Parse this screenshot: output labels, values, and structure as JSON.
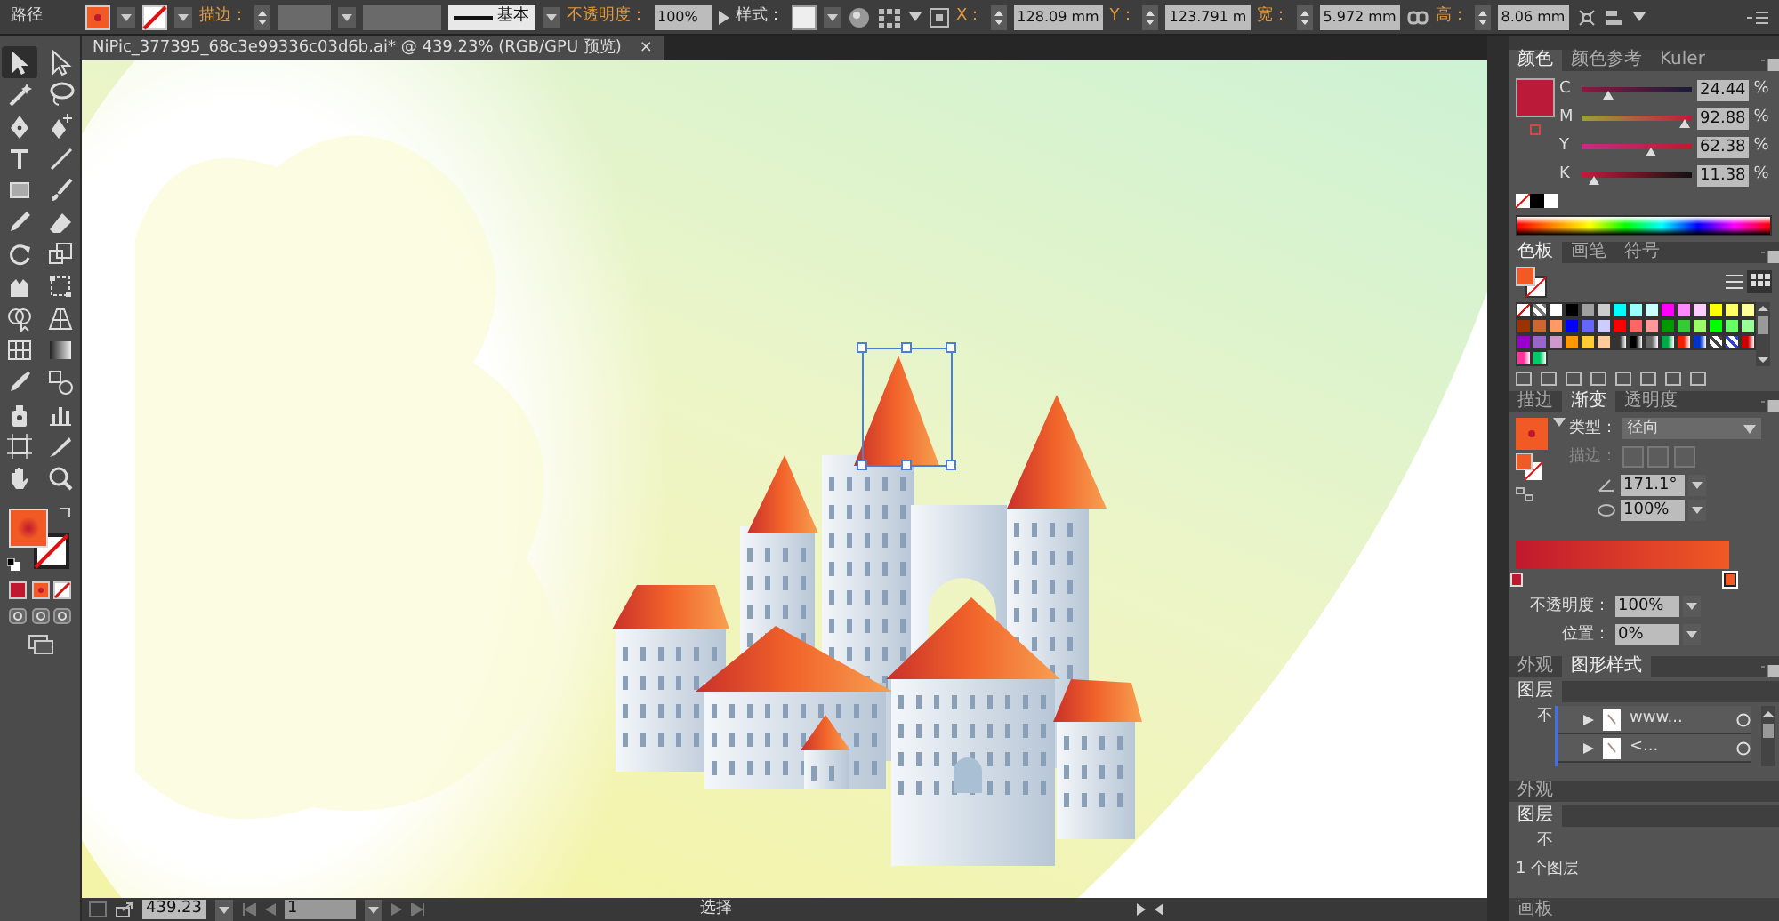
{
  "control_bar": {
    "object_type": "路径",
    "stroke_label": "描边：",
    "stroke_profile": "基本",
    "opacity_label": "不透明度：",
    "opacity": "100%",
    "style_label": "样式：",
    "x_label": "X：",
    "x": "128.09 mm",
    "y_label": "Y：",
    "y": "123.791 m",
    "w_label": "宽：",
    "w": "5.972 mm",
    "h_label": "高：",
    "h": "8.06 mm"
  },
  "document_tab": {
    "title": "NiPic_377395_68c3e99336c03d6b.ai* @ 439.23% (RGB/GPU 预览)",
    "close": "×"
  },
  "tools": [
    {
      "kind": "selection",
      "selected": true
    },
    {
      "kind": "direct-selection",
      "selected": false
    },
    {
      "kind": "magic-wand",
      "selected": false
    },
    {
      "kind": "lasso",
      "selected": false
    },
    {
      "kind": "pen",
      "selected": false
    },
    {
      "kind": "pen-add",
      "selected": false
    },
    {
      "kind": "type",
      "selected": false
    },
    {
      "kind": "line",
      "selected": false
    },
    {
      "kind": "rectangle",
      "selected": false
    },
    {
      "kind": "brush",
      "selected": false
    },
    {
      "kind": "pencil",
      "selected": false
    },
    {
      "kind": "eraser",
      "selected": false
    },
    {
      "kind": "rotate",
      "selected": false
    },
    {
      "kind": "scale",
      "selected": false
    },
    {
      "kind": "warp",
      "selected": false
    },
    {
      "kind": "free-transform",
      "selected": false
    },
    {
      "kind": "shape-builder",
      "selected": false
    },
    {
      "kind": "perspective",
      "selected": false
    },
    {
      "kind": "mesh",
      "selected": false
    },
    {
      "kind": "gradient",
      "selected": false
    },
    {
      "kind": "eyedropper",
      "selected": false
    },
    {
      "kind": "blend",
      "selected": false
    },
    {
      "kind": "sprayer",
      "selected": false
    },
    {
      "kind": "graph",
      "selected": false
    },
    {
      "kind": "artboard",
      "selected": false
    },
    {
      "kind": "slice",
      "selected": false
    },
    {
      "kind": "hand",
      "selected": false
    },
    {
      "kind": "zoom",
      "selected": false
    }
  ],
  "color_panel": {
    "tabs": [
      {
        "label": "颜色",
        "selected": true
      },
      {
        "label": "颜色参考",
        "selected": false
      },
      {
        "label": "Kuler",
        "selected": false
      }
    ],
    "channels": [
      {
        "label": "C",
        "value": "24.44",
        "unit": "%",
        "level": 0.2444
      },
      {
        "label": "M",
        "value": "92.88",
        "unit": "%",
        "level": 0.9288
      },
      {
        "label": "Y",
        "value": "62.38",
        "unit": "%",
        "level": 0.6238
      },
      {
        "label": "K",
        "value": "11.38",
        "unit": "%",
        "level": 0.1138
      }
    ]
  },
  "swatches_panel": {
    "tabs": [
      {
        "label": "色板",
        "selected": true
      },
      {
        "label": "画笔",
        "selected": false
      },
      {
        "label": "符号",
        "selected": false
      }
    ],
    "swatches": [
      {
        "kind": "none"
      },
      {
        "kind": "pattern",
        "color": "#777777"
      },
      {
        "kind": "color",
        "color": "#ffffff"
      },
      {
        "kind": "color",
        "color": "#000000"
      },
      {
        "kind": "color",
        "color": "#a0a0a0"
      },
      {
        "kind": "color",
        "color": "#cccccc"
      },
      {
        "kind": "color",
        "color": "#00ffff"
      },
      {
        "kind": "color",
        "color": "#99ffff"
      },
      {
        "kind": "color",
        "color": "#ccffff"
      },
      {
        "kind": "color",
        "color": "#ff00ff"
      },
      {
        "kind": "color",
        "color": "#ff88ff"
      },
      {
        "kind": "color",
        "color": "#ffccff"
      },
      {
        "kind": "color",
        "color": "#ffff00"
      },
      {
        "kind": "color",
        "color": "#ffff66"
      },
      {
        "kind": "color",
        "color": "#ffff99"
      },
      {
        "kind": "color",
        "color": "#993300"
      },
      {
        "kind": "color",
        "color": "#cc6633"
      },
      {
        "kind": "color",
        "color": "#ff9966"
      },
      {
        "kind": "color",
        "color": "#0000ff"
      },
      {
        "kind": "color",
        "color": "#6666ff"
      },
      {
        "kind": "color",
        "color": "#ccccff"
      },
      {
        "kind": "color",
        "color": "#ff0000"
      },
      {
        "kind": "color",
        "color": "#ff6666"
      },
      {
        "kind": "color",
        "color": "#ff9999"
      },
      {
        "kind": "color",
        "color": "#009900"
      },
      {
        "kind": "color",
        "color": "#33cc33"
      },
      {
        "kind": "color",
        "color": "#99ff66"
      },
      {
        "kind": "color",
        "color": "#00ff00"
      },
      {
        "kind": "color",
        "color": "#66ff66"
      },
      {
        "kind": "color",
        "color": "#99ff99"
      },
      {
        "kind": "color",
        "color": "#9900cc"
      },
      {
        "kind": "color",
        "color": "#9966cc"
      },
      {
        "kind": "color",
        "color": "#cc99cc"
      },
      {
        "kind": "color",
        "color": "#ff9900"
      },
      {
        "kind": "color",
        "color": "#ffcc33"
      },
      {
        "kind": "color",
        "color": "#ffcc99"
      },
      {
        "kind": "gradient",
        "color": "#333333"
      },
      {
        "kind": "gradient",
        "color": "#000000"
      },
      {
        "kind": "gradient",
        "color": "#666666"
      },
      {
        "kind": "gradient",
        "color": "#00aa44"
      },
      {
        "kind": "gradient",
        "color": "#ee2200"
      },
      {
        "kind": "gradient",
        "color": "#0033cc"
      },
      {
        "kind": "pattern",
        "color": "#444444"
      },
      {
        "kind": "pattern",
        "color": "#3344cc"
      },
      {
        "kind": "gradient",
        "color": "#cc0000"
      },
      {
        "kind": "gradient",
        "color": "#ff3399"
      },
      {
        "kind": "gradient",
        "color": "#00cc66"
      }
    ]
  },
  "gradient_panel": {
    "tabs": [
      {
        "label": "描边",
        "selected": false
      },
      {
        "label": "渐变",
        "selected": true
      },
      {
        "label": "透明度",
        "selected": false
      }
    ],
    "type_label": "类型：",
    "type": "径向",
    "stroke_label": "描边：",
    "angle": "171.1°",
    "aspect": "100%",
    "stops": [
      {
        "color": "#c0182e",
        "selected": false
      },
      {
        "color": "#f15a24",
        "selected": true
      }
    ],
    "opacity_label": "不透明度：",
    "opacity": "100%",
    "location_label": "位置：",
    "location": "0%"
  },
  "appearance_tabs": [
    {
      "label": "外观",
      "selected": false
    },
    {
      "label": "图形样式",
      "selected": true
    }
  ],
  "layers_panel": {
    "title": "图层",
    "caption": "不",
    "rows": [
      {
        "name": "www...",
        "expanded": false
      },
      {
        "name": "<...",
        "expanded": false
      }
    ]
  },
  "lower_panels": {
    "appearance_title": "外观",
    "layers_title": "图层",
    "caption": "不",
    "layer_count": "1 个图层",
    "artboards_title": "画板"
  },
  "status_bar": {
    "zoom": "439.23",
    "artboard": "1",
    "tool": "选择"
  }
}
